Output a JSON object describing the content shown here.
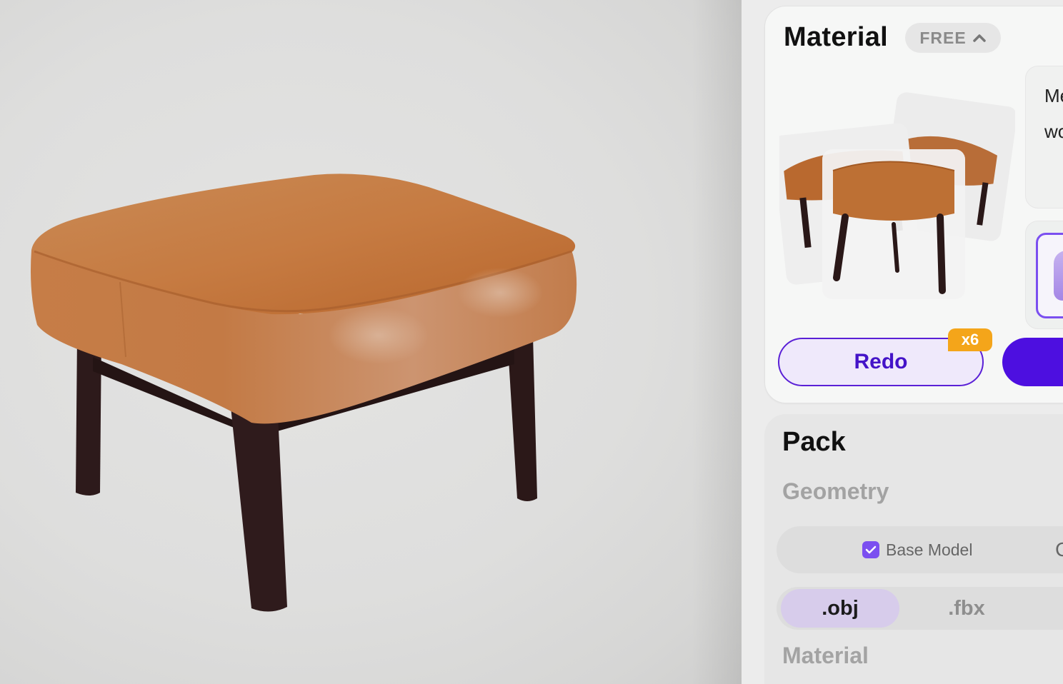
{
  "viewport": {
    "object": "ottoman-3d-model",
    "colors": {
      "leather": "#c4773e",
      "legs": "#2d1a1a",
      "background": "#dededd"
    }
  },
  "material_card": {
    "title": "Material",
    "badge": "FREE",
    "badge_icon": "chevron-up-icon",
    "preview_text_line1": "Me",
    "preview_text_line2": "wo",
    "redo_label": "Redo",
    "redo_count": "x6",
    "colors": {
      "accent": "#4d0fe0",
      "badge": "#f4a51a",
      "redo_bg": "#efe9fb"
    }
  },
  "pack_card": {
    "title": "Pack",
    "geometry_label": "Geometry",
    "base_model_label": "Base Model",
    "base_model_checked": true,
    "next_option_partial": "C",
    "formats": [
      {
        "label": ".obj",
        "selected": true
      },
      {
        "label": ".fbx",
        "selected": false
      }
    ],
    "material_label": "Material"
  }
}
